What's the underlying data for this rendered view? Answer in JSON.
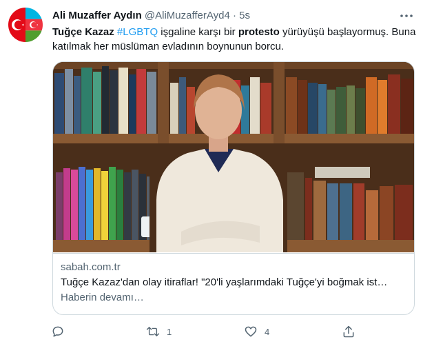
{
  "tweet": {
    "author_name": "Ali Muzaffer Aydın",
    "author_handle": "@AliMuzafferAyd4",
    "separator": "·",
    "time": "5s",
    "text": {
      "part1": "Tuğçe Kazaz",
      "part2": " ",
      "hashtag": "#LGBTQ",
      "part3": " işgaline karşı bir ",
      "bold": "protesto",
      "part4": " yürüyüşü başlayormuş. Buna katılmak her müslüman evladının boynunun borcu."
    }
  },
  "card": {
    "domain": "sabah.com.tr",
    "title": "Tuğçe Kazaz'dan olay itiraflar! \"20'li yaşlarımdaki Tuğçe'yi boğmak ist…",
    "description": "Haberin devamı…"
  },
  "actions": {
    "reply_count": "",
    "retweet_count": "1",
    "like_count": "4",
    "share_count": ""
  },
  "icons": {
    "avatar": "turkey-azerbaijan-flag-avatar",
    "more": "more-icon",
    "reply": "reply-icon",
    "retweet": "retweet-icon",
    "like": "heart-icon",
    "share": "share-icon"
  },
  "colors": {
    "accent": "#1d9bf0",
    "secondary_text": "#536471",
    "border": "#cfd9de"
  }
}
